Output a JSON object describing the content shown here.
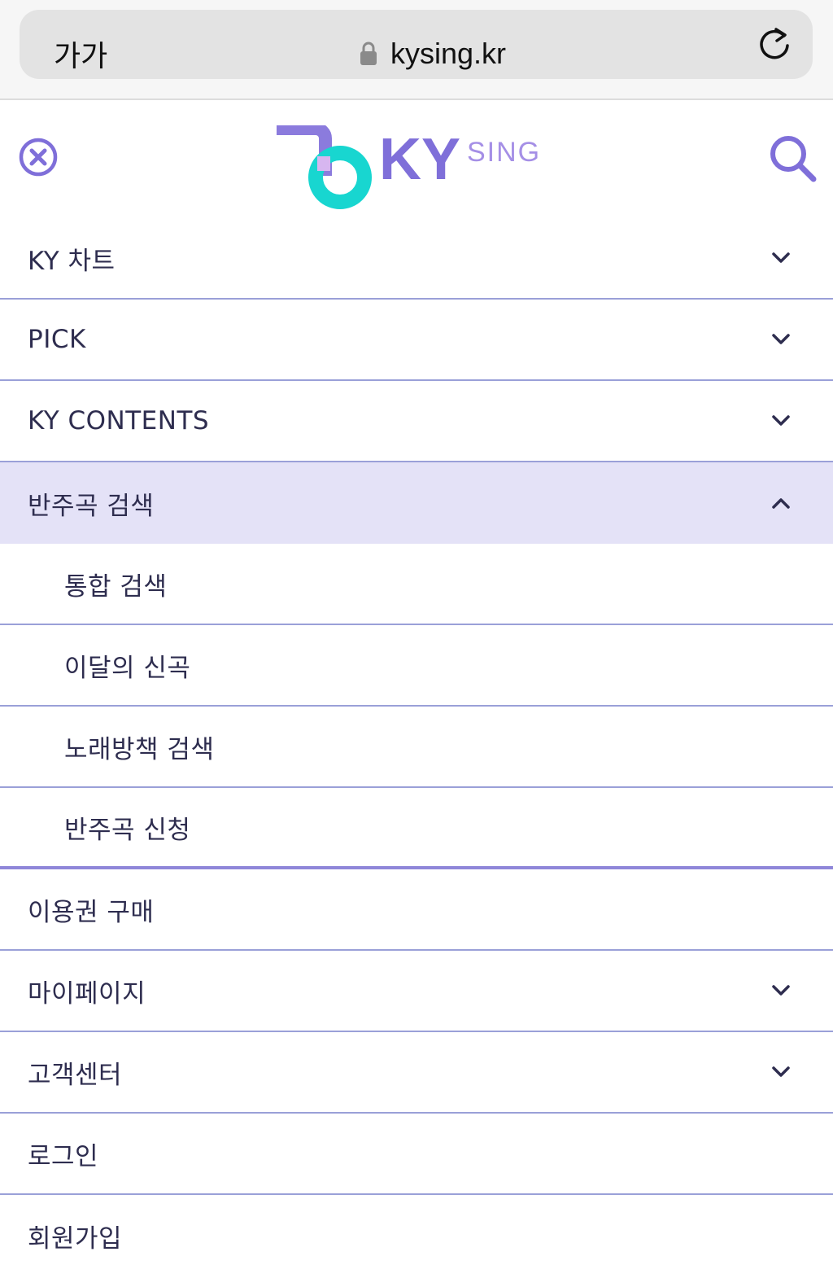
{
  "browser": {
    "text_size_label": "가가",
    "url": "kysing.kr"
  },
  "header": {
    "logo_text": "KY",
    "logo_sub": "SING"
  },
  "menu": [
    {
      "label": "KY 차트",
      "type": "top",
      "chevron": "down"
    },
    {
      "label": "PICK",
      "type": "top",
      "chevron": "down"
    },
    {
      "label": "KY CONTENTS",
      "type": "top",
      "chevron": "down"
    },
    {
      "label": "반주곡 검색",
      "type": "top",
      "chevron": "up",
      "expanded": true
    },
    {
      "label": "통합 검색",
      "type": "sub"
    },
    {
      "label": "이달의 신곡",
      "type": "sub"
    },
    {
      "label": "노래방책 검색",
      "type": "sub"
    },
    {
      "label": "반주곡 신청",
      "type": "sub"
    },
    {
      "label": "이용권 구매",
      "type": "top"
    },
    {
      "label": "마이페이지",
      "type": "top",
      "chevron": "down"
    },
    {
      "label": "고객센터",
      "type": "top",
      "chevron": "down"
    },
    {
      "label": "로그인",
      "type": "top"
    },
    {
      "label": "회원가입",
      "type": "top"
    }
  ],
  "colors": {
    "accent": "#7f6fd9",
    "teal": "#18d6d0",
    "active_bg": "#e4e2f7",
    "divider": "#9aa0d8"
  }
}
